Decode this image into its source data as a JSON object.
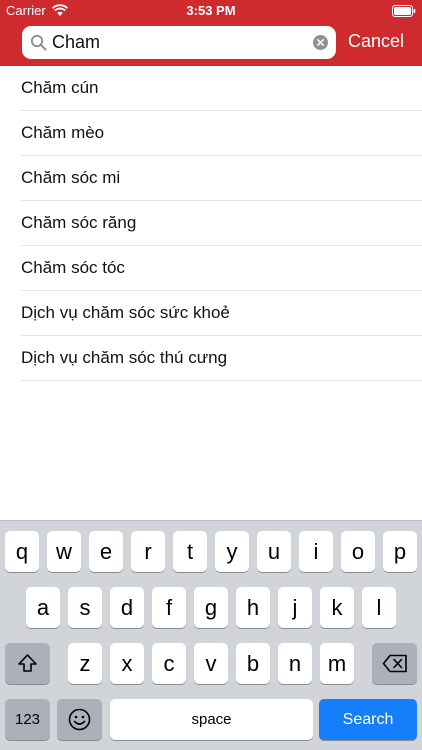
{
  "status_bar": {
    "carrier": "Carrier",
    "time": "3:53 PM"
  },
  "search": {
    "value": "Cham",
    "cancel_label": "Cancel"
  },
  "colors": {
    "header": "#cf2a2d",
    "search_key": "#157efb",
    "keyboard_bg": "#d1d4d9"
  },
  "results": [
    {
      "label": "Chăm cún"
    },
    {
      "label": "Chăm mèo"
    },
    {
      "label": "Chăm sóc mi"
    },
    {
      "label": "Chăm sóc răng"
    },
    {
      "label": "Chăm sóc tóc"
    },
    {
      "label": "Dịch vụ chăm sóc sức khoẻ"
    },
    {
      "label": "Dịch vụ chăm sóc thú cưng"
    }
  ],
  "keyboard": {
    "row1": [
      "q",
      "w",
      "e",
      "r",
      "t",
      "y",
      "u",
      "i",
      "o",
      "p"
    ],
    "row2": [
      "a",
      "s",
      "d",
      "f",
      "g",
      "h",
      "j",
      "k",
      "l"
    ],
    "row3": [
      "z",
      "x",
      "c",
      "v",
      "b",
      "n",
      "m"
    ],
    "numbers_label": "123",
    "space_label": "space",
    "search_label": "Search",
    "icons": {
      "shift": "shift-icon",
      "delete": "delete-icon",
      "emoji": "emoji-icon"
    }
  }
}
